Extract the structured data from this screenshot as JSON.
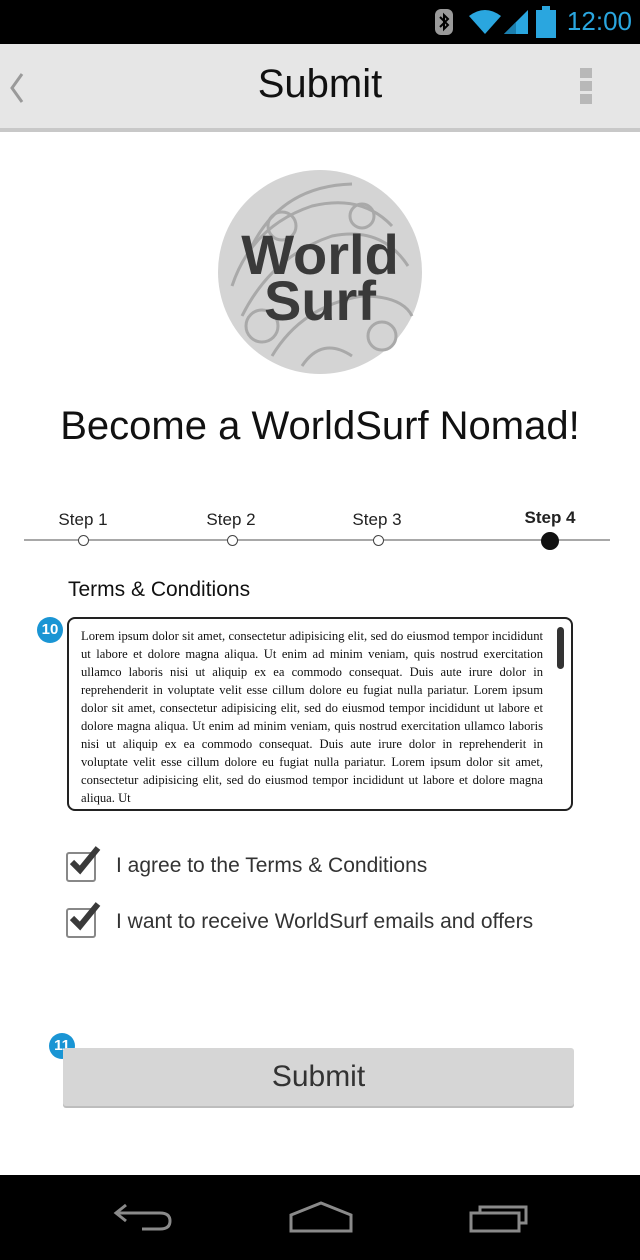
{
  "status_bar": {
    "time": "12:00",
    "icons": [
      "bluetooth-icon",
      "wifi-icon",
      "signal-icon",
      "battery-icon"
    ],
    "accent_color": "#2aa6df"
  },
  "action_bar": {
    "title": "Submit"
  },
  "logo": {
    "text_line1": "World",
    "text_line2": "Surf"
  },
  "headline": "Become a WorldSurf Nomad!",
  "stepper": {
    "steps": [
      {
        "label": "Step 1",
        "active": false
      },
      {
        "label": "Step 2",
        "active": false
      },
      {
        "label": "Step 3",
        "active": false
      },
      {
        "label": "Step 4",
        "active": true
      }
    ]
  },
  "terms": {
    "title": "Terms & Conditions",
    "badge": "10",
    "text": "Lorem ipsum dolor sit amet, consectetur adipisicing elit, sed do eiusmod tempor incididunt ut labore et dolore magna aliqua. Ut enim ad minim veniam, quis nostrud exercitation ullamco laboris nisi ut aliquip ex ea commodo consequat. Duis aute irure dolor in reprehenderit in voluptate velit esse cillum dolore eu fugiat nulla pariatur. Lorem ipsum dolor sit amet, consectetur adipisicing elit, sed do eiusmod tempor incididunt ut labore et dolore magna aliqua. Ut enim ad minim veniam, quis nostrud exercitation ullamco laboris nisi ut aliquip ex ea commodo consequat. Duis aute irure dolor in reprehenderit in voluptate velit esse cillum dolore eu fugiat nulla pariatur. Lorem ipsum dolor sit amet, consectetur adipisicing elit, sed do eiusmod tempor incididunt ut labore et dolore magna aliqua. Ut"
  },
  "checkboxes": [
    {
      "label": "I agree to the Terms & Conditions",
      "checked": true
    },
    {
      "label": "I want to receive WorldSurf emails and offers",
      "checked": true
    }
  ],
  "submit": {
    "label": "Submit",
    "badge": "11"
  },
  "nav_bar": {
    "icons": [
      "back-icon",
      "home-icon",
      "recent-apps-icon"
    ]
  }
}
